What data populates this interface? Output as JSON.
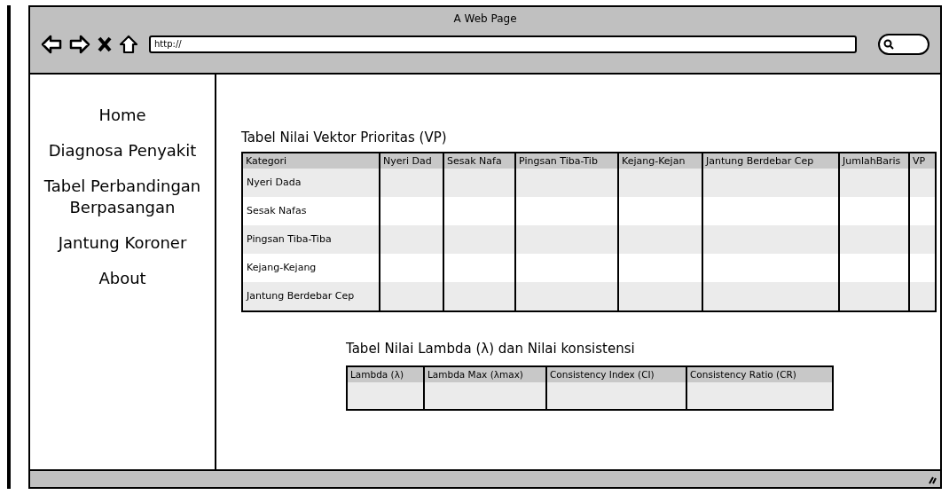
{
  "window": {
    "title": "A Web Page"
  },
  "address_bar": {
    "value": "http://"
  },
  "sidebar": {
    "items": [
      "Home",
      "Diagnosa Penyakit",
      "Tabel Perbandingan Berpasangan",
      "Jantung Koroner",
      "About"
    ]
  },
  "vp_table": {
    "title": "Tabel Nilai Vektor Prioritas (VP)",
    "columns": [
      "Kategori",
      "Nyeri Dad",
      "Sesak Nafa",
      "Pingsan Tiba-Tib",
      "Kejang-Kejan",
      "Jantung Berdebar Cep",
      "JumlahBaris",
      "VP"
    ],
    "rows": [
      [
        "Nyeri Dada"
      ],
      [
        "Sesak Nafas"
      ],
      [
        "Pingsan Tiba-Tiba"
      ],
      [
        "Kejang-Kejang"
      ],
      [
        "Jantung Berdebar Cep"
      ]
    ]
  },
  "lambda_table": {
    "title": "Tabel Nilai Lambda (λ) dan Nilai konsistensi",
    "columns": [
      "Lambda (λ)",
      "Lambda Max (λmax)",
      "Consistency Index (CI)",
      "Consistency Ratio (CR)"
    ]
  }
}
